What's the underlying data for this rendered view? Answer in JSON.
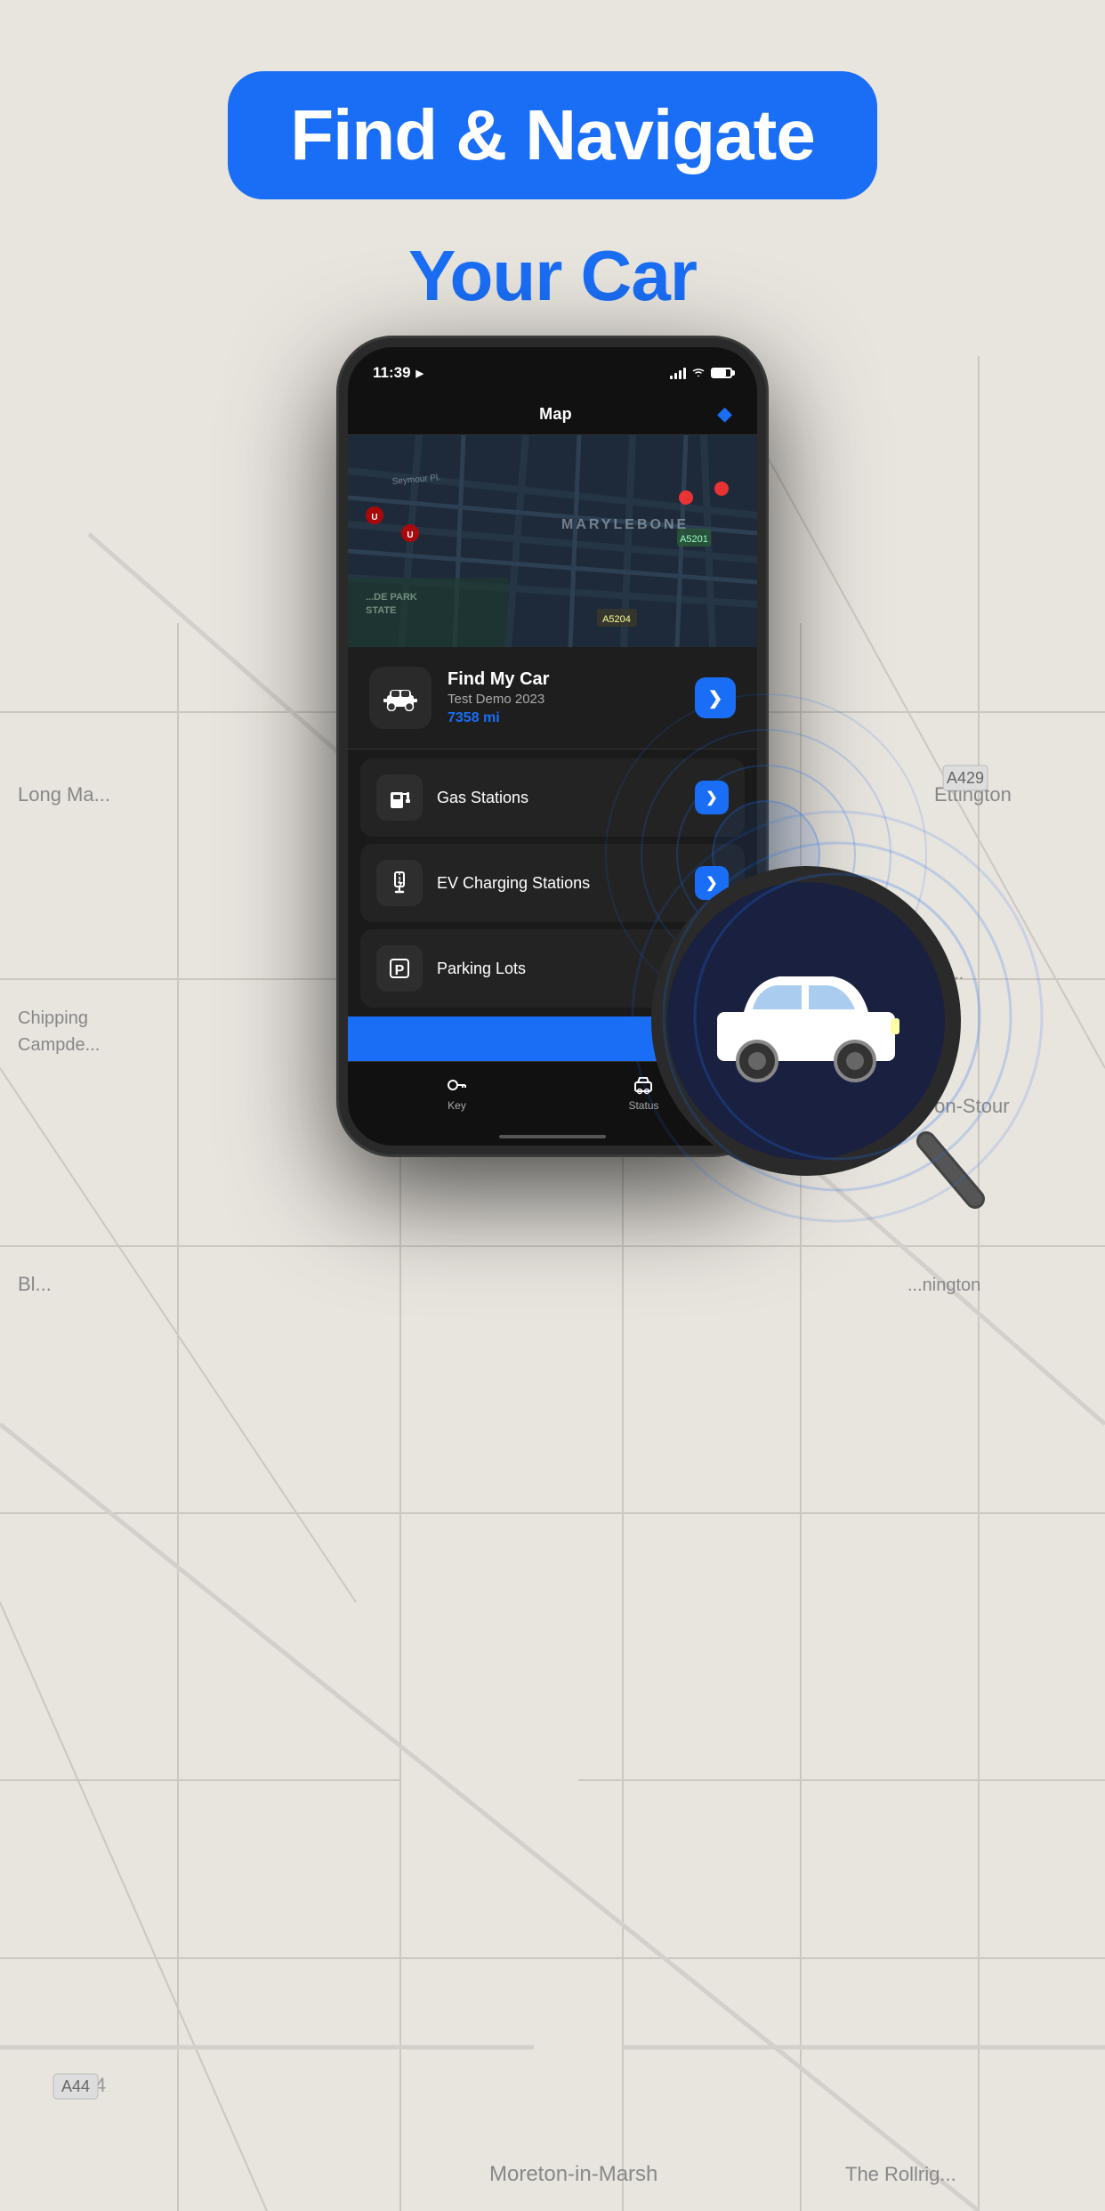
{
  "header": {
    "badge_line1": "Find & Navigate",
    "subtitle": "Your Car"
  },
  "phone": {
    "status_bar": {
      "time": "11:39",
      "arrow": "▶",
      "signal": "●●●",
      "wifi": "WiFi",
      "battery": "75"
    },
    "nav": {
      "title": "Map",
      "diamond_icon": "◆"
    },
    "map": {
      "neighborhood": "MARYLEBONE"
    },
    "find_car_card": {
      "title": "Find My Car",
      "subtitle": "Test Demo 2023",
      "mileage": "7358 mi",
      "arrow": "❯"
    },
    "menu_items": [
      {
        "id": "gas-stations",
        "label": "Gas Stations",
        "icon": "⛽",
        "arrow": "❯"
      },
      {
        "id": "ev-charging",
        "label": "EV Charging Stations",
        "icon": "⚡",
        "arrow": "❯"
      },
      {
        "id": "parking",
        "label": "Parking Lots",
        "icon": "P",
        "arrow": "❯"
      }
    ],
    "bottom_nav": [
      {
        "id": "key",
        "icon": "🔑",
        "label": "Key"
      },
      {
        "id": "status",
        "icon": "🚗",
        "label": "Status"
      }
    ]
  },
  "bg_map": {
    "city_label": "Moreton-in-Marsh"
  },
  "colors": {
    "accent": "#1a6ef5",
    "header_bg": "#f0ede8",
    "phone_bg": "#1a1a1a"
  }
}
